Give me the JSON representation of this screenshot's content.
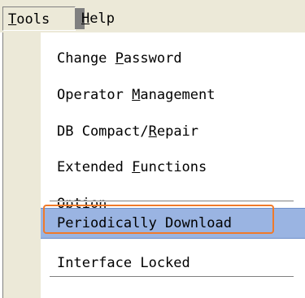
{
  "menubar": {
    "items": [
      {
        "label_pre": "",
        "mnemonic": "T",
        "label_post": "ools"
      },
      {
        "label_pre": "",
        "mnemonic": "H",
        "label_post": "elp"
      }
    ]
  },
  "tools_menu": {
    "items": [
      {
        "label_pre": "Change ",
        "mnemonic": "P",
        "label_post": "assword"
      },
      {
        "label_pre": "Operator ",
        "mnemonic": "M",
        "label_post": "anagement"
      },
      {
        "label_pre": "DB Compact/",
        "mnemonic": "R",
        "label_post": "epair"
      },
      {
        "label_pre": "Extended ",
        "mnemonic": "F",
        "label_post": "unctions"
      },
      {
        "label_pre": "Option",
        "mnemonic": "",
        "label_post": ""
      },
      {
        "label_pre": "Periodically Download",
        "mnemonic": "",
        "label_post": ""
      },
      {
        "label_pre": "Interface Locked",
        "mnemonic": "",
        "label_post": ""
      }
    ],
    "highlighted_index": 5
  },
  "colors": {
    "menubar_bg": "#ece9d8",
    "highlight_bg": "#9ab4e2",
    "focus_ring": "#f07a2a"
  }
}
